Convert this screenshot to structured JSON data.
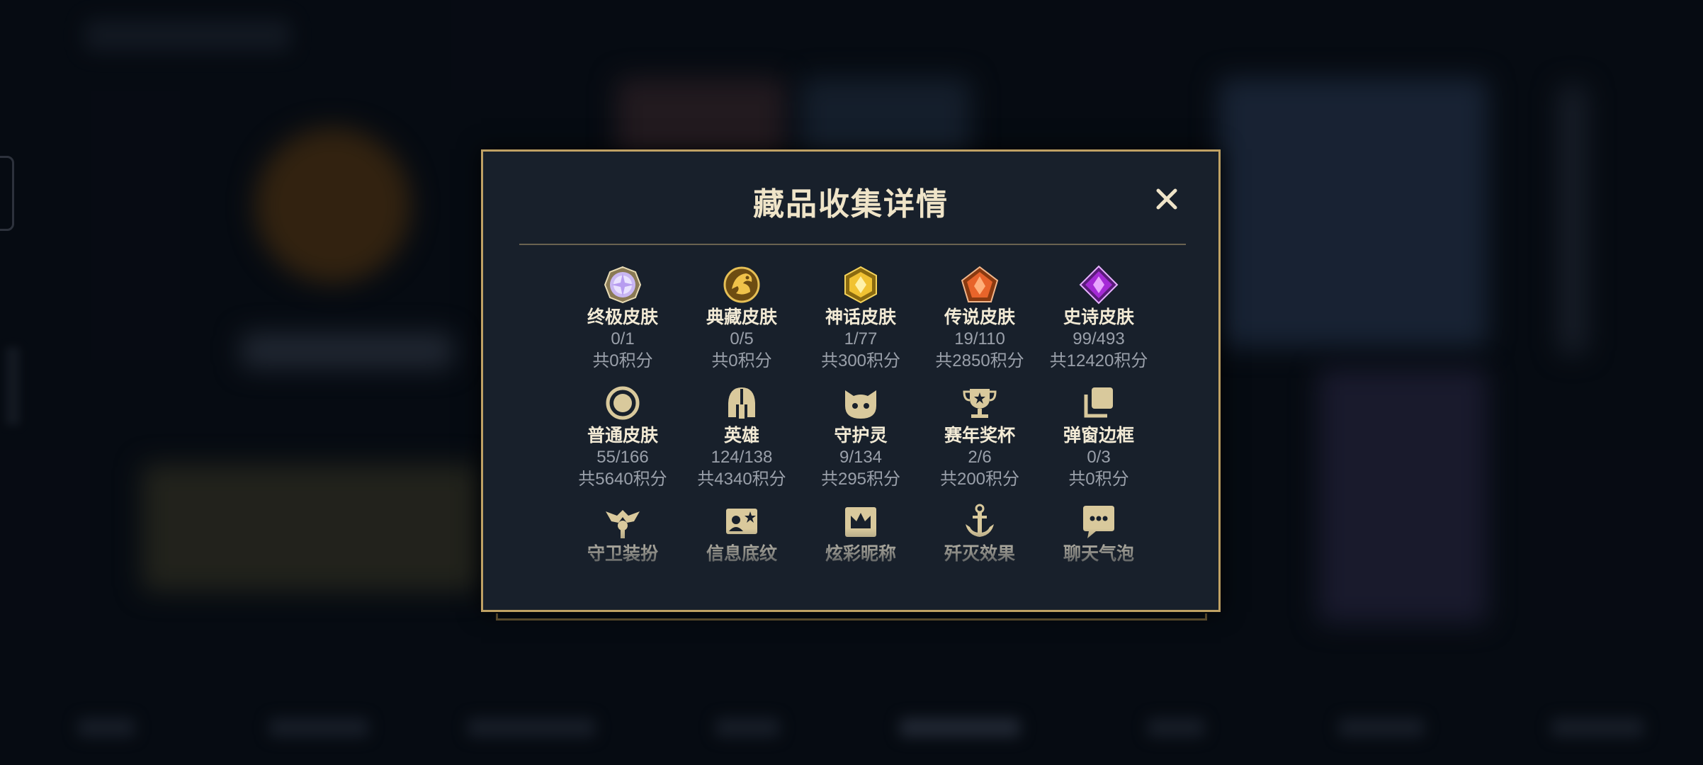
{
  "modal": {
    "title": "藏品收集详情",
    "close_label": "✕"
  },
  "categories": [
    {
      "name": "终极皮肤",
      "count": "0/1",
      "points": "共0积分",
      "icon": "ultimate-gem-icon"
    },
    {
      "name": "典藏皮肤",
      "count": "0/5",
      "points": "共0积分",
      "icon": "dragon-emblem-icon"
    },
    {
      "name": "神话皮肤",
      "count": "1/77",
      "points": "共300积分",
      "icon": "mythic-gem-icon"
    },
    {
      "name": "传说皮肤",
      "count": "19/110",
      "points": "共2850积分",
      "icon": "legendary-gem-icon"
    },
    {
      "name": "史诗皮肤",
      "count": "99/493",
      "points": "共12420积分",
      "icon": "epic-gem-icon"
    },
    {
      "name": "普通皮肤",
      "count": "55/166",
      "points": "共5640积分",
      "icon": "standard-skin-icon"
    },
    {
      "name": "英雄",
      "count": "124/138",
      "points": "共4340积分",
      "icon": "helmet-icon"
    },
    {
      "name": "守护灵",
      "count": "9/134",
      "points": "共295积分",
      "icon": "little-legend-icon"
    },
    {
      "name": "赛年奖杯",
      "count": "2/6",
      "points": "共200积分",
      "icon": "trophy-icon"
    },
    {
      "name": "弹窗边框",
      "count": "0/3",
      "points": "共0积分",
      "icon": "frame-stack-icon"
    },
    {
      "name": "守卫装扮",
      "count": "",
      "points": "",
      "icon": "ward-icon"
    },
    {
      "name": "信息底纹",
      "count": "",
      "points": "",
      "icon": "banner-icon"
    },
    {
      "name": "炫彩昵称",
      "count": "",
      "points": "",
      "icon": "crown-icon"
    },
    {
      "name": "歼灭效果",
      "count": "",
      "points": "",
      "icon": "anchor-icon"
    },
    {
      "name": "聊天气泡",
      "count": "",
      "points": "",
      "icon": "chat-bubble-icon"
    }
  ],
  "colors": {
    "gold_border": "#bfa164",
    "panel_bg": "#18202b",
    "title_text": "#efe4c8",
    "muted_text": "#9aa0aa",
    "icon_gold": "#d9c99c"
  }
}
